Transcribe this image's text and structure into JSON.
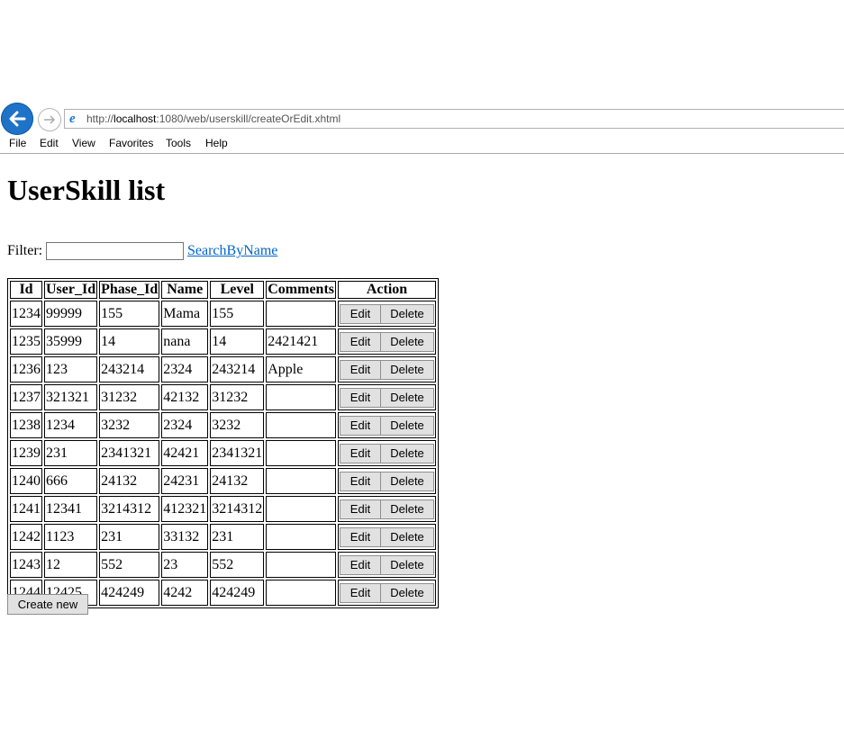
{
  "browser": {
    "url_prefix": "http://",
    "url_host": "localhost",
    "url_rest": ":1080/web/userskill/createOrEdit.xhtml",
    "menu": [
      "File",
      "Edit",
      "View",
      "Favorites",
      "Tools",
      "Help"
    ]
  },
  "page": {
    "title": "UserSkill list",
    "filter_label": "Filter:",
    "filter_value": "",
    "search_link": "SearchByName",
    "create_button": "Create new"
  },
  "table": {
    "headers": [
      "Id",
      "User_Id",
      "Phase_Id",
      "Name",
      "Level",
      "Comments",
      "Action"
    ],
    "edit_label": "Edit",
    "delete_label": "Delete",
    "rows": [
      [
        "1234",
        "99999",
        "155",
        "Mama",
        "155",
        ""
      ],
      [
        "1235",
        "35999",
        "14",
        "nana",
        "14",
        "2421421"
      ],
      [
        "1236",
        "123",
        "243214",
        "2324",
        "243214",
        "Apple"
      ],
      [
        "1237",
        "321321",
        "31232",
        "42132",
        "31232",
        ""
      ],
      [
        "1238",
        "1234",
        "3232",
        "2324",
        "3232",
        ""
      ],
      [
        "1239",
        "231",
        "2341321",
        "42421",
        "2341321",
        ""
      ],
      [
        "1240",
        "666",
        "24132",
        "24231",
        "24132",
        ""
      ],
      [
        "1241",
        "12341",
        "3214312",
        "412321",
        "3214312",
        ""
      ],
      [
        "1242",
        "1123",
        "231",
        "33132",
        "231",
        ""
      ],
      [
        "1243",
        "12",
        "552",
        "23",
        "552",
        ""
      ],
      [
        "1244",
        "12425",
        "424249",
        "4242",
        "424249",
        ""
      ]
    ]
  },
  "icons": {
    "back": "back-arrow-icon",
    "forward": "forward-arrow-icon",
    "site": "ie-logo-icon"
  }
}
